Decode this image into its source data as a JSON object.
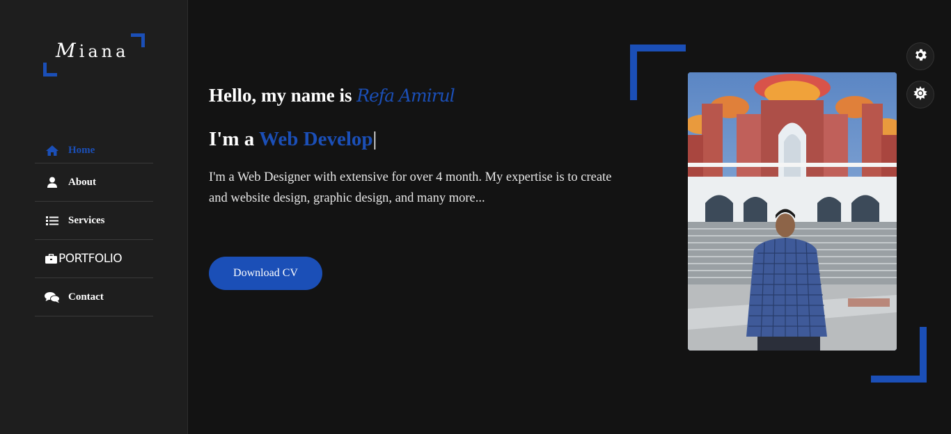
{
  "brand": {
    "logo_initial": "M",
    "logo_rest": "iana"
  },
  "nav": {
    "items": [
      {
        "label": "Home",
        "icon": "home-icon",
        "active": true
      },
      {
        "label": "About",
        "icon": "user-icon",
        "active": false
      },
      {
        "label": "Services",
        "icon": "list-icon",
        "active": false
      },
      {
        "label": "PORTFOLIO",
        "icon": "briefcase-icon",
        "active": false
      },
      {
        "label": "Contact",
        "icon": "comments-icon",
        "active": false
      }
    ]
  },
  "hero": {
    "greeting_prefix": "Hello, my name is ",
    "name": "Refa Amirul",
    "role_prefix": "I'm a ",
    "role_typed": "Web Develop",
    "cursor": "|",
    "bio": "I'm a Web Designer with extensive for over 4 month. My expertise is to create and website design, graphic design, and many more...",
    "cv_button": "Download CV"
  },
  "controls": {
    "settings_icon": "gear-icon",
    "theme_icon": "sun-icon"
  },
  "colors": {
    "accent": "#1b4fb7",
    "background": "#131313",
    "sidebar": "#1e1e1e",
    "text": "#ffffff"
  }
}
